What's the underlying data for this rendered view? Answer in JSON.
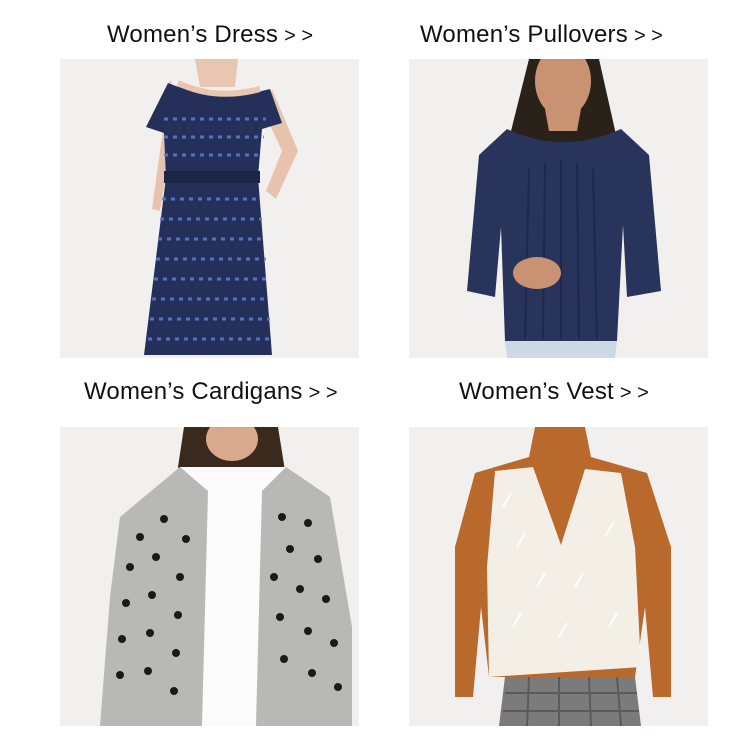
{
  "categories": [
    {
      "title": "Women’s Dress",
      "arrows": "> >",
      "image": "navy-knit-dress-photo"
    },
    {
      "title": "Women’s Pullovers",
      "arrows": "> >",
      "image": "navy-cable-knit-pullover-photo"
    },
    {
      "title": "Women’s Cardigans",
      "arrows": "> >",
      "image": "grey-polka-dot-cardigan-photo"
    },
    {
      "title": "Women’s Vest",
      "arrows": "> >",
      "image": "white-fuzzy-vest-over-turtleneck-photo"
    }
  ],
  "colors": {
    "background": "#ffffff",
    "photo_bg": "#f1f0ee",
    "navy": "#25305a",
    "grey_knit": "#b8b8b6",
    "camel": "#b8692b",
    "ivory_fur": "#f3eee6"
  }
}
